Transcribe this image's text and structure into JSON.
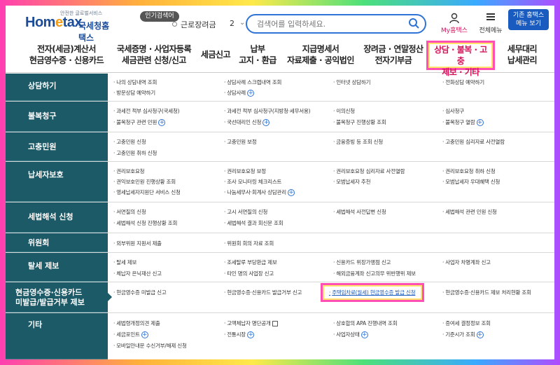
{
  "header": {
    "logo_small": "안전한 글로벌서비스",
    "logo_brand_a": "Hom",
    "logo_brand_e": "e",
    "logo_brand_b": "tax",
    "logo_kr": "국세청홈택스",
    "popular_label": "인기검색어",
    "popular_item": "근로장려금",
    "popular_num": "2",
    "search_placeholder": "검색어를 입력하세요.",
    "myhome_label": "My홈택스",
    "allmenu_label": "전체메뉴",
    "oldhome_line1": "기존 홈택스",
    "oldhome_line2": "메뉴 보기"
  },
  "nav": [
    {
      "l1": "전자(세금)계산서",
      "l2": "현금영수증 · 신용카드"
    },
    {
      "l1": "국세증명 · 사업자등록",
      "l2": "세금관련 신청/신고"
    },
    {
      "l1": "세금신고",
      "l2": ""
    },
    {
      "l1": "납부",
      "l2": "고지 · 환급"
    },
    {
      "l1": "지급명세서",
      "l2": "자료제출 · 공익법인"
    },
    {
      "l1": "장려금 · 연말정산",
      "l2": "전자기부금"
    },
    {
      "l1": "상담 · 불복 · 고충",
      "l2": "제보 · 기타"
    },
    {
      "l1": "세무대리",
      "l2": "납세관리"
    }
  ],
  "rows": [
    {
      "head": "상담하기",
      "cols": [
        [
          "나의 상담내역 조회",
          "방문상담 예약하기"
        ],
        [
          "상담사례 스크랩내역 조회",
          "상담사례"
        ],
        [
          "인터넷 상담하기"
        ],
        [
          "전화상담 예약하기"
        ]
      ]
    },
    {
      "head": "불복청구",
      "cols": [
        [
          "과세전 적부 심사청구(국세청)",
          "불복청구 관련 민원"
        ],
        [
          "과세전 적부 심사청구(지방청·세무서용)",
          "국선대리인 신청"
        ],
        [
          "이의신청",
          "불복청구 진행상황 조회"
        ],
        [
          "심사청구",
          "불복청구 열람"
        ]
      ]
    },
    {
      "head": "고충민원",
      "cols": [
        [
          "고충민원 신청",
          "고충민원 취하 신청"
        ],
        [
          "고충민원 보정"
        ],
        [
          "금융증빙 등 조회 신청"
        ],
        [
          "고충민원 심리자료 사전열람"
        ]
      ]
    },
    {
      "head": "납세자보호",
      "cols": [
        [
          "권리보호요청",
          "권익보호민원 진행상황 조회",
          "영세납세자지원단 서비스 신청"
        ],
        [
          "권리보호요청 보정",
          "조사 모니터링 체크리스트",
          "나눔세무사·회계사 상담관리"
        ],
        [
          "권리보호요청 심리자료 사전열람",
          "모범납세자 추천"
        ],
        [
          "권리보호요청 취하 신청",
          "모범납세자 우대혜택 신청"
        ]
      ]
    },
    {
      "head": "세법해석 신청",
      "cols": [
        [
          "서면질의 신청",
          "세법해석 신청 진행상황 조회"
        ],
        [
          "고시 서면질의 신청",
          "세법해석 결과 회신문 조회"
        ],
        [
          "세법해석 사전답변 신청"
        ],
        [
          "세법해석 관련 민원 신청"
        ]
      ]
    },
    {
      "head": "위원회",
      "cols": [
        [
          "외부위원 지원서 제출"
        ],
        [
          "위원회 회의 자료 조회"
        ],
        [],
        []
      ]
    },
    {
      "head": "탈세 제보",
      "cols": [
        [
          "탈세 제보",
          "체납자 은닉재산 신고"
        ],
        [
          "조세탈루 부당환급 제보",
          "타인 명의 사업장 신고"
        ],
        [
          "신용카드 위장가맹점 신고",
          "해외금융계좌 신고의무 위반행위 제보"
        ],
        [
          "사업자 차명계좌 신고"
        ]
      ]
    },
    {
      "head1": "현금영수증·신용카드",
      "head2": "미발급/발급거부 제보",
      "cols": [
        [
          "현금영수증 미발급 신고"
        ],
        [
          "현금영수증·신용카드 발급거부 신고"
        ],
        [
          "주택임차료(월세) 현금영수증 발급 신청"
        ],
        [
          "현금영수증·신용카드 제보 처리현황 조회"
        ]
      ]
    },
    {
      "head": "기타",
      "cols": [
        [
          "세법령개정의견 제출",
          "세금포인트",
          "모바일안내문 수신거부/해제 신청"
        ],
        [
          "고액체납자 명단공개",
          "전통시장"
        ],
        [
          "상호합의 APA 진행내역 조회",
          "사업자상태"
        ],
        [
          "증여세 결정정보 조회",
          "기준시가 조회"
        ]
      ]
    }
  ]
}
